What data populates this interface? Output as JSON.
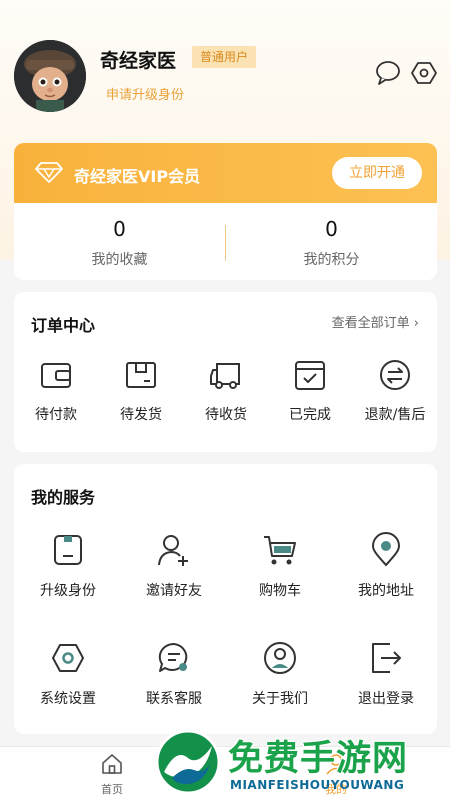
{
  "profile": {
    "username": "奇经家医",
    "badge": "普通用户",
    "upgrade_link": "申请升级身份",
    "message_icon": "chat-bubble-icon",
    "settings_icon": "hexagon-gear-icon"
  },
  "vip": {
    "title": "奇经家医VIP会员",
    "button": "立即开通",
    "icon": "diamond-icon"
  },
  "stats": [
    {
      "value": "0",
      "label": "我的收藏"
    },
    {
      "value": "0",
      "label": "我的积分"
    }
  ],
  "orders": {
    "title": "订单中心",
    "more": "查看全部订单",
    "items": [
      {
        "label": "待付款",
        "icon": "wallet-icon"
      },
      {
        "label": "待发货",
        "icon": "package-box-icon"
      },
      {
        "label": "待收货",
        "icon": "delivery-truck-icon"
      },
      {
        "label": "已完成",
        "icon": "calendar-check-icon"
      },
      {
        "label": "退款/售后",
        "icon": "exchange-arrows-icon"
      }
    ]
  },
  "services": {
    "title": "我的服务",
    "items": [
      {
        "label": "升级身份",
        "icon": "id-card-icon"
      },
      {
        "label": "邀请好友",
        "icon": "add-user-icon"
      },
      {
        "label": "购物车",
        "icon": "shopping-cart-icon"
      },
      {
        "label": "我的地址",
        "icon": "location-pin-icon"
      },
      {
        "label": "系统设置",
        "icon": "hexagon-gear-icon"
      },
      {
        "label": "联系客服",
        "icon": "customer-service-chat-icon"
      },
      {
        "label": "关于我们",
        "icon": "user-circle-icon"
      },
      {
        "label": "退出登录",
        "icon": "logout-icon"
      }
    ]
  },
  "nav": {
    "home": "首页",
    "mine": "我的"
  },
  "watermark": {
    "text": "免费手游网",
    "sub": "MIANFEISHOUYOUWANG"
  },
  "colors": {
    "accent": "#f8b23c",
    "accent_text": "#f0a236",
    "icon_teal": "#4a8a86"
  }
}
